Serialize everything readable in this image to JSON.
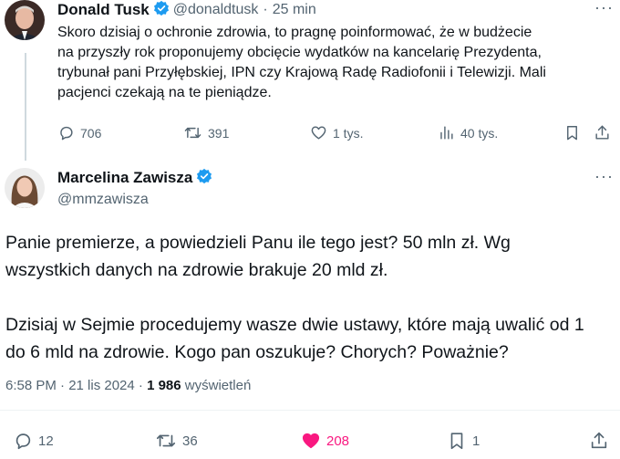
{
  "reply_to": {
    "author_name": "Donald Tusk",
    "handle": "@donaldtusk",
    "separator": "·",
    "time": "25 min",
    "text": "Skoro dzisiaj o ochronie zdrowia, to pragnę poinformować, że w budżecie\nna przyszły rok proponujemy obcięcie wydatków na kancelarię Prezydenta,\ntrybunał pani Przyłębskiej, IPN czy Krajową Radę Radiofonii i Telewizji. Mali\npacjenci czekają na te pieniądze.",
    "stats": {
      "replies": "706",
      "reposts": "391",
      "likes": "1 tys.",
      "views": "40 tys."
    }
  },
  "main_tweet": {
    "author_name": "Marcelina Zawisza",
    "handle": "@mmzawisza",
    "text": "Panie premierze, a powiedzieli Panu ile tego jest? 50 mln zł. Wg\nwszystkich danych na zdrowie brakuje 20 mld zł.\n\nDzisiaj w Sejmie procedujemy wasze dwie ustawy, które mają uwalić od 1\ndo 6 mld na zdrowie. Kogo pan oszukuje? Chorych? Poważnie?",
    "timestamp": "6:58 PM · 21 lis 2024 · ",
    "views_count": "1 986",
    "views_label": " wyświetleń",
    "stats": {
      "replies": "12",
      "reposts": "36",
      "likes": "208",
      "bookmarks": "1"
    }
  },
  "more_label": "···",
  "colors": {
    "verified": "#1d9bf0",
    "like_active": "#f91880",
    "secondary": "#536471"
  }
}
